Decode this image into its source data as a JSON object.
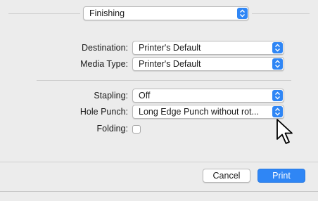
{
  "panel_selector": {
    "value": "Finishing"
  },
  "fields": {
    "destination": {
      "label": "Destination:",
      "value": "Printer's Default"
    },
    "media_type": {
      "label": "Media Type:",
      "value": "Printer's Default"
    },
    "stapling": {
      "label": "Stapling:",
      "value": "Off"
    },
    "hole_punch": {
      "label": "Hole Punch:",
      "value": "Long Edge Punch without rot..."
    },
    "folding": {
      "label": "Folding:",
      "checked": false
    }
  },
  "buttons": {
    "cancel": "Cancel",
    "print": "Print"
  },
  "colors": {
    "accent": "#2f86f5",
    "background": "#ececec"
  }
}
